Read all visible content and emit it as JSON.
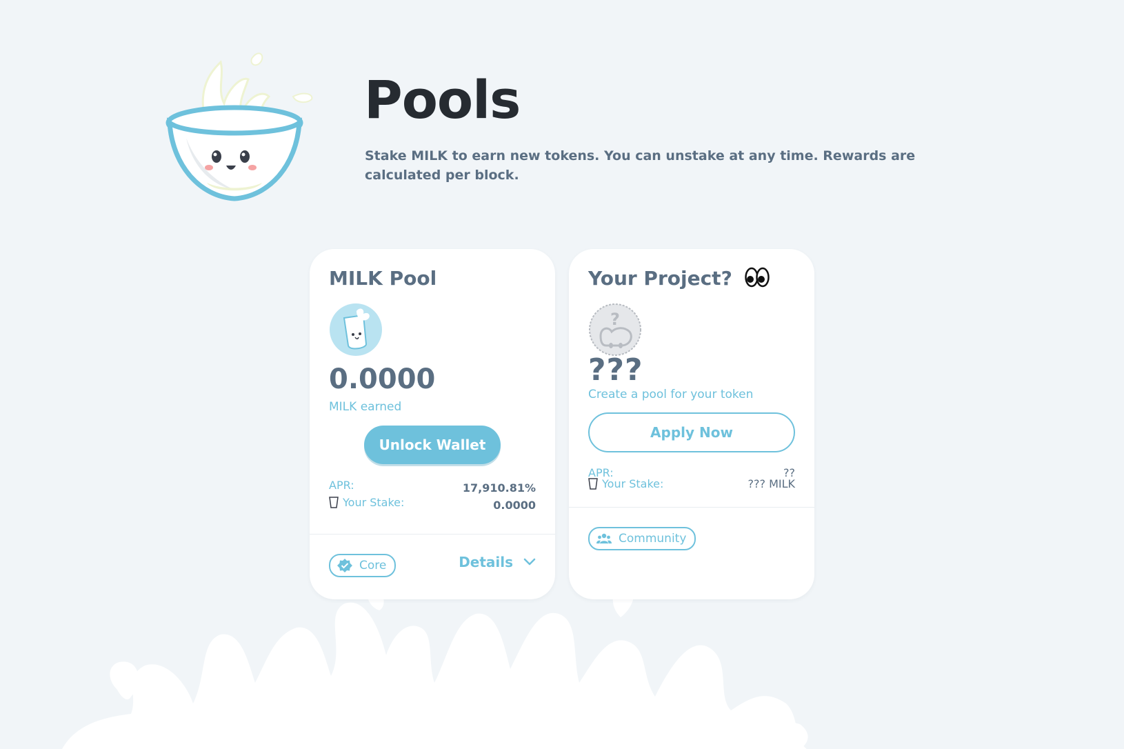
{
  "header": {
    "title": "Pools",
    "description": "Stake MILK to earn new tokens. You can unstake at any time. Rewards are calculated per block.",
    "mascot_icon": "milk-bowl-mascot-icon"
  },
  "pools": [
    {
      "title": "MILK Pool",
      "icon": "milk-glass-token-icon",
      "earned_value": "0.0000",
      "earned_label": "MILK earned",
      "unlock_label": "Unlock Wallet",
      "apr_label": "APR:",
      "apr_value": "17,910.81%",
      "stake_label": "Your Stake:",
      "stake_value": "0.0000",
      "tag_label": "Core",
      "tag_icon": "verified-badge-icon",
      "details_label": "Details"
    },
    {
      "title": "Your Project?",
      "title_icon": "eyes-icon",
      "icon": "mystery-token-icon",
      "placeholder_value": "???",
      "create_label": "Create a pool for your token",
      "apply_label": "Apply Now",
      "apr_label": "APR:",
      "apr_value": "??",
      "stake_label": "Your Stake:",
      "stake_value": "??? MILK",
      "tag_label": "Community",
      "tag_icon": "community-people-icon"
    }
  ],
  "colors": {
    "background": "#F1F5F8",
    "accent": "#6EC1DC",
    "text_dark": "#262B31",
    "text_muted": "#5A6E82",
    "card": "#FFFFFF"
  }
}
